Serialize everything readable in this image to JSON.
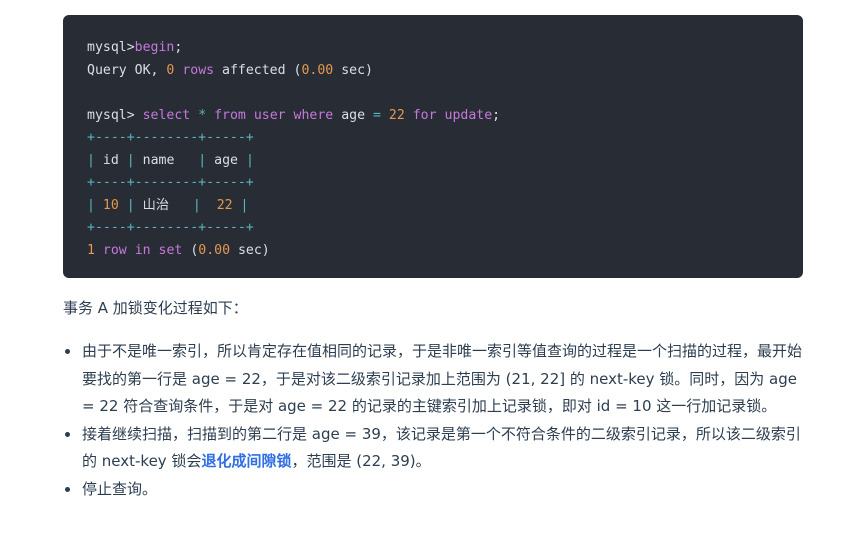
{
  "code": {
    "line1": {
      "prompt": "mysql>",
      "cmd": "begin",
      "end": ";"
    },
    "line2": {
      "a": "Query OK,",
      "n1": "0",
      "b": "rows",
      "c": "affected",
      "d": "(",
      "n2": "0.00",
      "e": "sec)"
    },
    "line3": {
      "prompt": "mysql>",
      "select": "select",
      "star": "*",
      "from": "from",
      "table": "user",
      "where": "where",
      "col": "age",
      "eq": "=",
      "val": "22",
      "for": "for",
      "update": "update",
      "end": ";"
    },
    "border": "+----+--------+-----+",
    "header": {
      "p1": "|",
      "c1": "id",
      "p2": "|",
      "c2": "name",
      "p3": "|",
      "c3": "age",
      "p4": "|"
    },
    "row": {
      "p1": "|",
      "c1": "10",
      "p2": "|",
      "c2": "山治",
      "p3": "|",
      "c3": "22",
      "p4": "|"
    },
    "summary": {
      "n": "1",
      "row": "row",
      "in": "in",
      "set": "set",
      "open": "(",
      "t": "0.00",
      "sec": "sec)"
    }
  },
  "intro": "事务 A 加锁变化过程如下：",
  "points": [
    {
      "text": "由于不是唯一索引，所以肯定存在值相同的记录，于是非唯一索引等值查询的过程是一个扫描的过程，最开始要找的第一行是 age = 22，于是对该二级索引记录加上范围为 (21, 22] 的 next-key 锁。同时，因为 age = 22 符合查询条件，于是对 age = 22 的记录的主键索引加上记录锁，即对 id = 10 这一行加记录锁。"
    },
    {
      "before": "接着继续扫描，扫描到的第二行是 age = 39，该记录是第一个不符合条件的二级索引记录，所以该二级索引的 next-key 锁会",
      "highlight": "退化成间隙锁",
      "after": "，范围是 (22, 39)。"
    },
    {
      "text": "停止查询。"
    }
  ],
  "colors": {
    "code_bg": "#282c34",
    "keyword": "#c678dd",
    "number": "#e5984f",
    "operator": "#56b6c2",
    "link": "#2f6ee5"
  }
}
